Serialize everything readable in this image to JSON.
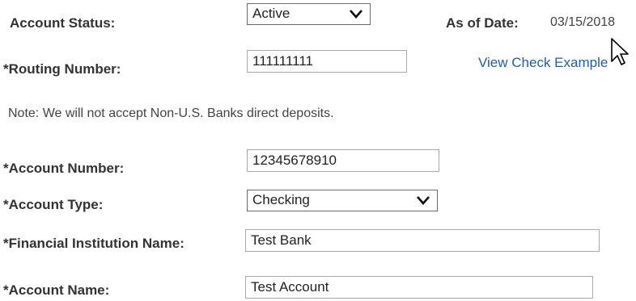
{
  "account_status": {
    "label": "Account Status:",
    "selected": "Active"
  },
  "as_of_date": {
    "label": "As of Date:",
    "value": "03/15/2018"
  },
  "routing_number": {
    "label": "*Routing Number:",
    "value": "111111111",
    "link": "View Check Example"
  },
  "note": "Note: We will not accept Non-U.S. Banks direct deposits.",
  "account_number": {
    "label": "*Account Number:",
    "value": "12345678910"
  },
  "account_type": {
    "label": "*Account Type:",
    "selected": "Checking"
  },
  "financial_institution": {
    "label": "*Financial Institution Name:",
    "value": "Test Bank"
  },
  "account_name": {
    "label": "*Account Name:",
    "value": "Test Account"
  },
  "colors": {
    "link": "#1f5fa8",
    "label": "#333333"
  },
  "icons": {
    "dropdown": "chevron-down-icon",
    "pointer": "mouse-cursor-icon"
  }
}
